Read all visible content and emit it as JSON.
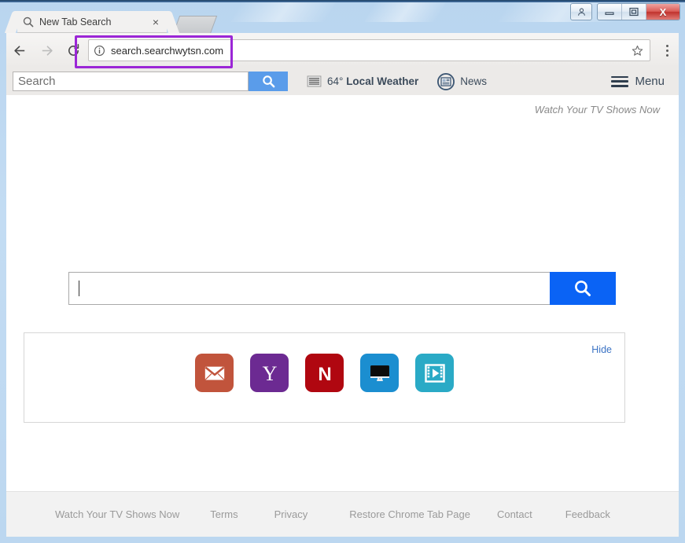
{
  "window": {
    "controls": [
      {
        "name": "user-account-button",
        "glyph": "person"
      },
      {
        "name": "minimize-button",
        "glyph": "minimize"
      },
      {
        "name": "maximize-button",
        "glyph": "maximize"
      },
      {
        "name": "close-button",
        "glyph": "X"
      }
    ]
  },
  "browser": {
    "tab": {
      "title": "New Tab Search",
      "favicon": "search-icon",
      "close_label": "×"
    },
    "new_tab_label": "+",
    "nav": {
      "back": "back-arrow-icon",
      "forward": "forward-arrow-icon",
      "reload": "reload-icon"
    },
    "omnibox": {
      "url": "search.searchwytsn.com",
      "security_icon": "info-icon",
      "bookmark_icon": "star-icon"
    },
    "menu_icon": "kebab-menu-icon"
  },
  "extension_bar": {
    "search": {
      "placeholder": "Search",
      "value": "",
      "button_icon": "search-icon"
    },
    "weather": {
      "icon": "weather-fog-icon",
      "temperature": "64°",
      "label": "Local Weather"
    },
    "news": {
      "icon": "newspaper-icon",
      "label": "News"
    },
    "menu": {
      "icon": "hamburger-icon",
      "label": "Menu"
    }
  },
  "page": {
    "tagline": "Watch Your TV Shows Now",
    "search": {
      "value": "",
      "placeholder": "",
      "button_icon": "search-icon"
    },
    "tiles_panel": {
      "hide_label": "Hide",
      "tiles": [
        {
          "name": "tile-gmail",
          "icon": "envelope-icon",
          "color": "#c1543c"
        },
        {
          "name": "tile-yahoo",
          "icon": "yahoo-y-icon",
          "color": "#6c2a92"
        },
        {
          "name": "tile-netflix",
          "icon": "netflix-n-icon",
          "color": "#b00710"
        },
        {
          "name": "tile-tv",
          "icon": "monitor-icon",
          "color": "#1b8ed0"
        },
        {
          "name": "tile-video",
          "icon": "film-play-icon",
          "color": "#2aaac6"
        }
      ]
    },
    "footer_links": [
      "Watch Your TV Shows Now",
      "Terms",
      "Privacy",
      "Restore Chrome Tab Page",
      "Contact",
      "Feedback"
    ]
  },
  "colors": {
    "accent_blue": "#0a63f5",
    "ext_blue": "#5a9cea",
    "annotation_purple": "#9b26d6",
    "link_blue": "#3b73c4"
  }
}
